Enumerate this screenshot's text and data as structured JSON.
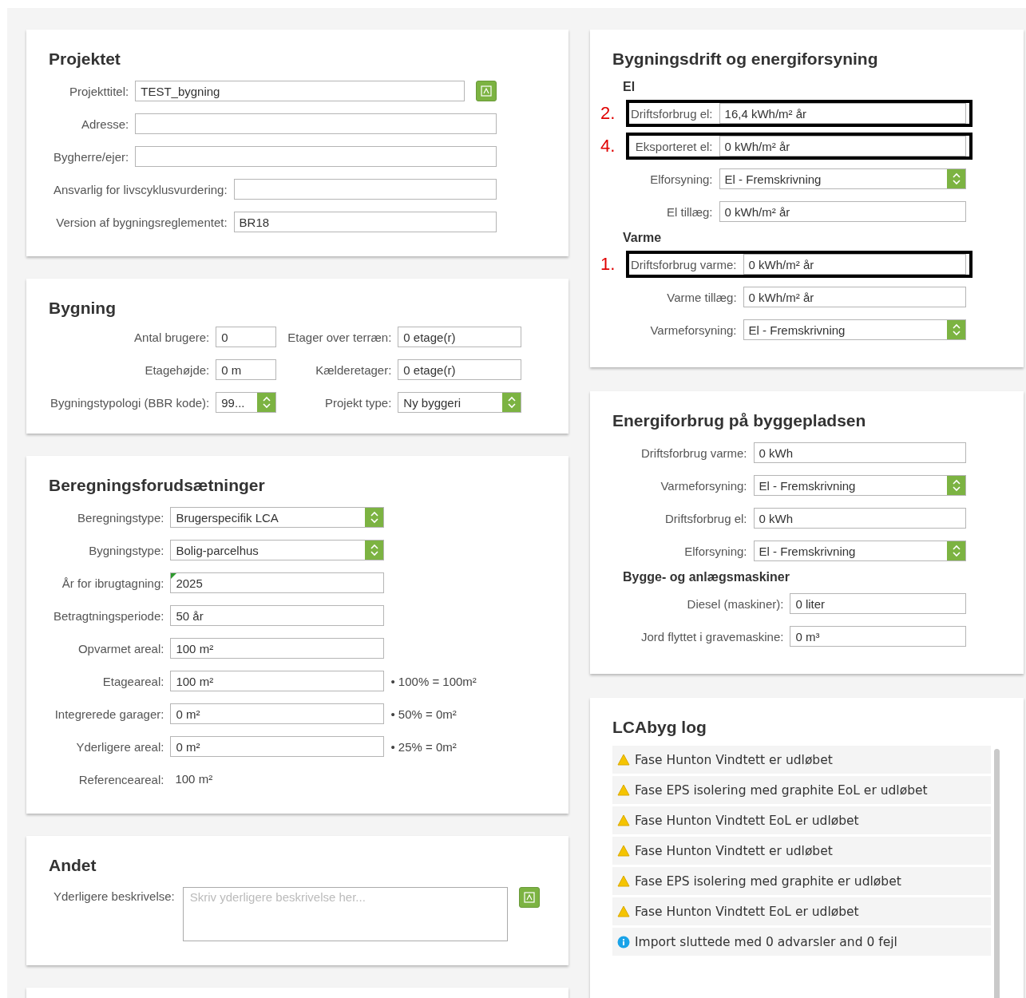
{
  "left_column": [
    {
      "kind": "form",
      "title": "Projektet",
      "groups": [
        {
          "rows": [
            {
              "label": "Projekttitel:",
              "kind": "text",
              "value": "TEST_bygning",
              "button": true
            },
            {
              "label": "Adresse:",
              "kind": "text",
              "button": false
            },
            {
              "label": "Bygherre/ejer:",
              "kind": "text",
              "button": false
            }
          ]
        },
        {
          "rows": [
            {
              "label": "Ansvarlig for livscyklusvurdering:",
              "kind": "text",
              "button": false
            },
            {
              "label": "Version af bygningsreglementet:",
              "kind": "text",
              "value": "BR18",
              "button": false
            }
          ]
        }
      ]
    },
    {
      "kind": "pairs",
      "title": "Bygning",
      "rows": [
        {
          "cells": [
            {
              "label": "Antal brugere:",
              "kind": "text",
              "value": "0"
            },
            {
              "label": "Etager over terræn:",
              "kind": "text",
              "value": "0 etage(r)"
            }
          ]
        },
        {
          "cells": [
            {
              "label": "Etagehøjde:",
              "kind": "text",
              "value": "0 m"
            },
            {
              "label": "Kælderetager:",
              "kind": "text",
              "value": "0 etage(r)"
            }
          ]
        },
        {
          "cells": [
            {
              "label": "Bygningstypologi (BBR kode):",
              "kind": "select",
              "value": "99..."
            },
            {
              "label": "Projekt type:",
              "kind": "select",
              "value": "Ny byggeri"
            }
          ]
        }
      ]
    },
    {
      "kind": "form",
      "title": "Beregningsforudsætninger",
      "groups": [
        {
          "rows": [
            {
              "label": "Beregningstype:",
              "kind": "select",
              "value": "Brugerspecifik LCA",
              "flagged": false
            },
            {
              "label": "Bygningstype:",
              "kind": "select",
              "value": "Bolig-parcelhus",
              "flagged": false
            },
            {
              "label": "År for ibrugtagning:",
              "kind": "text",
              "value": "2025",
              "flagged": true
            },
            {
              "label": "Betragtningsperiode:",
              "kind": "text",
              "value": "50 år",
              "flagged": false
            },
            {
              "label": "Opvarmet areal:",
              "kind": "text",
              "value": "100 m²",
              "flagged": false
            },
            {
              "label": "Etageareal:",
              "kind": "text",
              "value": "100 m²",
              "note": "• 100% = 100m²",
              "flagged": false
            },
            {
              "label": "Integrerede garager:",
              "kind": "text",
              "value": "0 m²",
              "note": "• 50% = 0m²",
              "flagged": false
            },
            {
              "label": "Yderligere areal:",
              "kind": "text",
              "value": "0 m²",
              "note": "• 25% = 0m²",
              "flagged": false
            },
            {
              "label": "Referenceareal:",
              "kind": "static",
              "value": "100 m²",
              "flagged": false
            }
          ]
        }
      ]
    },
    {
      "kind": "form",
      "title": "Andet",
      "groups": [
        {
          "rows": [
            {
              "label": "Yderligere beskrivelse:",
              "kind": "textarea",
              "placeholder": "Skriv yderligere beskrivelse her...",
              "button": true
            }
          ]
        }
      ]
    },
    {
      "kind": "blank"
    }
  ],
  "right_column": [
    {
      "kind": "form",
      "title": "Bygningsdrift og energiforsyning",
      "groups": [
        {
          "heading": "El",
          "rows": [
            {
              "label": "Driftsforbrug el:",
              "kind": "text",
              "value": "16,4 kWh/m² år",
              "highlighted": true,
              "annotation": "2."
            },
            {
              "label": "Eksporteret el:",
              "kind": "text",
              "value": "0 kWh/m² år",
              "highlighted": true,
              "annotation": "4."
            },
            {
              "label": "Elforsyning:",
              "kind": "select",
              "value": "El - Fremskrivning",
              "highlighted": false
            },
            {
              "label": "El tillæg:",
              "kind": "text",
              "value": "0 kWh/m² år",
              "highlighted": false
            }
          ]
        },
        {
          "heading": "Varme",
          "rows": [
            {
              "label": "Driftsforbrug varme:",
              "kind": "text",
              "value": "0 kWh/m² år",
              "highlighted": true,
              "annotation": "1."
            },
            {
              "label": "Varme tillæg:",
              "kind": "text",
              "value": "0 kWh/m² år",
              "highlighted": false
            },
            {
              "label": "Varmeforsyning:",
              "kind": "select",
              "value": "El - Fremskrivning",
              "highlighted": false
            }
          ]
        }
      ]
    },
    {
      "kind": "form",
      "title": "Energiforbrug på byggepladsen",
      "groups": [
        {
          "rows": [
            {
              "label": "Driftsforbrug varme:",
              "kind": "text",
              "value": "0 kWh"
            },
            {
              "label": "Varmeforsyning:",
              "kind": "select",
              "value": "El - Fremskrivning"
            },
            {
              "label": "Driftsforbrug el:",
              "kind": "text",
              "value": "0 kWh"
            },
            {
              "label": "Elforsyning:",
              "kind": "select",
              "value": "El - Fremskrivning"
            }
          ]
        },
        {
          "heading": "Bygge- og anlægsmaskiner",
          "rows": [
            {
              "label": "Diesel (maskiner):",
              "kind": "text",
              "value": "0 liter"
            },
            {
              "label": "Jord flyttet i gravemaskine:",
              "kind": "text",
              "value": "0 m³"
            }
          ]
        }
      ]
    },
    {
      "kind": "log",
      "title": "LCAbyg log",
      "entries": [
        {
          "kind": "warning",
          "text": "Fase Hunton Vindtett er udløbet"
        },
        {
          "kind": "warning",
          "text": "Fase EPS isolering med graphite EoL er udløbet"
        },
        {
          "kind": "warning",
          "text": "Fase Hunton Vindtett EoL er udløbet"
        },
        {
          "kind": "warning",
          "text": "Fase Hunton Vindtett er udløbet"
        },
        {
          "kind": "warning",
          "text": "Fase EPS isolering med graphite er udløbet"
        },
        {
          "kind": "warning",
          "text": "Fase Hunton Vindtett EoL er udløbet"
        },
        {
          "kind": "info",
          "text": "Import sluttede med 0 advarsler and 0 fejl"
        }
      ]
    }
  ]
}
